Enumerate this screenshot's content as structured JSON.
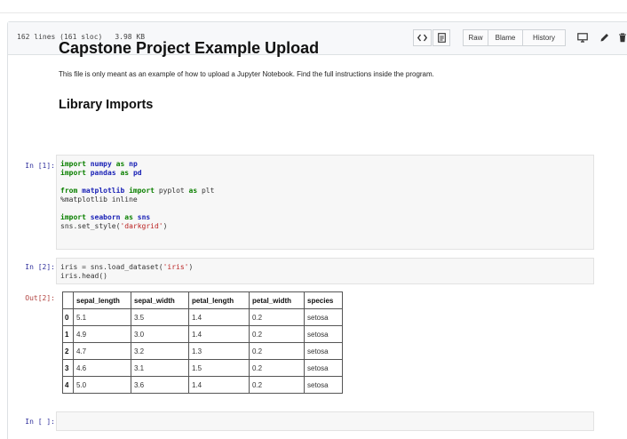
{
  "file_header": {
    "lines": "162 lines (161 sloc)",
    "size": "3.98 KB",
    "buttons": {
      "raw": "Raw",
      "blame": "Blame",
      "history": "History"
    }
  },
  "notebook": {
    "title": "Capstone Project Example Upload",
    "description": "This file is only meant as an example of how to upload a Jupyter Notebook. Find the full instructions inside the program.",
    "section_heading": "Library Imports",
    "cells": [
      {
        "prompt": "In [1]:",
        "lines": [
          [
            {
              "t": "import",
              "c": "kw"
            },
            {
              "t": " "
            },
            {
              "t": "numpy",
              "c": "nm"
            },
            {
              "t": " "
            },
            {
              "t": "as",
              "c": "kw"
            },
            {
              "t": " "
            },
            {
              "t": "np",
              "c": "nm"
            }
          ],
          [
            {
              "t": "import",
              "c": "kw"
            },
            {
              "t": " "
            },
            {
              "t": "pandas",
              "c": "nm"
            },
            {
              "t": " "
            },
            {
              "t": "as",
              "c": "kw"
            },
            {
              "t": " "
            },
            {
              "t": "pd",
              "c": "nm"
            }
          ],
          [],
          [
            {
              "t": "from",
              "c": "kw"
            },
            {
              "t": " "
            },
            {
              "t": "matplotlib",
              "c": "nm"
            },
            {
              "t": " "
            },
            {
              "t": "import",
              "c": "kw"
            },
            {
              "t": " pyplot "
            },
            {
              "t": "as",
              "c": "kw"
            },
            {
              "t": " plt"
            }
          ],
          [
            {
              "t": "%matplotlib inline"
            }
          ],
          [],
          [
            {
              "t": "import",
              "c": "kw"
            },
            {
              "t": " "
            },
            {
              "t": "seaborn",
              "c": "nm"
            },
            {
              "t": " "
            },
            {
              "t": "as",
              "c": "kw"
            },
            {
              "t": " "
            },
            {
              "t": "sns",
              "c": "nm"
            }
          ],
          [
            {
              "t": "sns.set_style("
            },
            {
              "t": "'darkgrid'",
              "c": "str"
            },
            {
              "t": ")"
            }
          ]
        ]
      },
      {
        "prompt": "In [2]:",
        "lines": [
          [
            {
              "t": "iris = sns.load_dataset("
            },
            {
              "t": "'iris'",
              "c": "str"
            },
            {
              "t": ")"
            }
          ],
          [
            {
              "t": "iris.head()"
            }
          ]
        ]
      },
      {
        "prompt": "In [ ]:",
        "lines": []
      }
    ],
    "output_prompt": "Out[2]:",
    "table": {
      "columns": [
        "",
        "sepal_length",
        "sepal_width",
        "petal_length",
        "petal_width",
        "species"
      ],
      "rows": [
        [
          "0",
          "5.1",
          "3.5",
          "1.4",
          "0.2",
          "setosa"
        ],
        [
          "1",
          "4.9",
          "3.0",
          "1.4",
          "0.2",
          "setosa"
        ],
        [
          "2",
          "4.7",
          "3.2",
          "1.3",
          "0.2",
          "setosa"
        ],
        [
          "3",
          "4.6",
          "3.1",
          "1.5",
          "0.2",
          "setosa"
        ],
        [
          "4",
          "5.0",
          "3.6",
          "1.4",
          "0.2",
          "setosa"
        ]
      ]
    }
  },
  "icons": [
    "code-icon",
    "document-icon",
    "desktop-icon",
    "pencil-icon",
    "trash-icon"
  ]
}
